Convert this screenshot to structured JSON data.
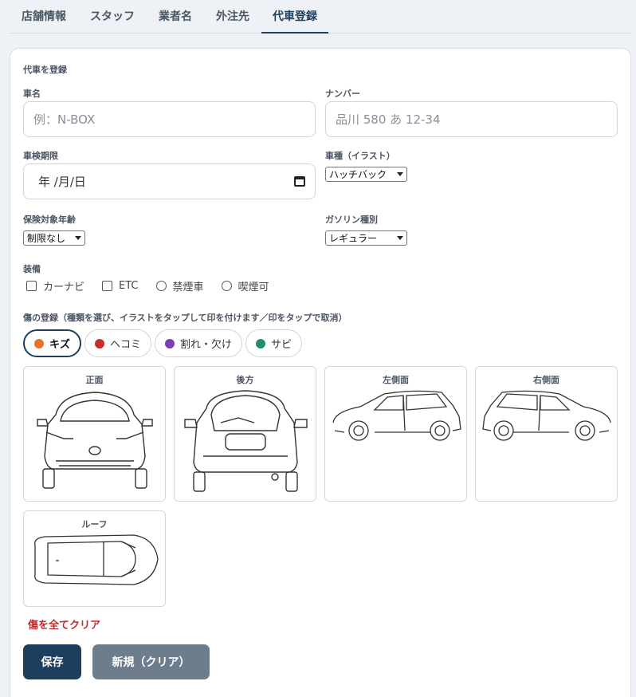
{
  "tabs": [
    {
      "label": "店舗情報"
    },
    {
      "label": "スタッフ"
    },
    {
      "label": "業者名"
    },
    {
      "label": "外注先"
    },
    {
      "label": "代車登録"
    }
  ],
  "form": {
    "title": "代車を登録",
    "name_label": "車名",
    "name_placeholder": "例：N-BOX",
    "number_label": "ナンバー",
    "number_placeholder": "品川 580 あ 12-34",
    "inspection_label": "車検期限",
    "inspection_value": "年 /月/日",
    "type_label": "車種（イラスト）",
    "type_value": "ハッチバック",
    "insurance_label": "保険対象年齢",
    "insurance_value": "制限なし",
    "fuel_label": "ガソリン種別",
    "fuel_value": "レギュラー",
    "equipment_label": "装備",
    "equipment": [
      "カーナビ",
      "ETC",
      "禁煙車",
      "喫煙可"
    ]
  },
  "damage": {
    "title": "傷の登録（種類を選び、イラストをタップして印を付けます／印をタップで取消）",
    "types": [
      {
        "label": "キズ",
        "color": "#e8742a"
      },
      {
        "label": "ヘコミ",
        "color": "#c3302f"
      },
      {
        "label": "割れ・欠け",
        "color": "#7a3fb8"
      },
      {
        "label": "サビ",
        "color": "#1f9163"
      }
    ],
    "views": [
      "正面",
      "後方",
      "左側面",
      "右側面",
      "ルーフ"
    ],
    "clear_label": "傷を全てクリア"
  },
  "buttons": {
    "save": "保存",
    "new": "新規（クリア）"
  },
  "colors": {
    "primary": "#1c3f5e",
    "secondary": "#6e7d8c",
    "danger": "#c62b2b"
  }
}
